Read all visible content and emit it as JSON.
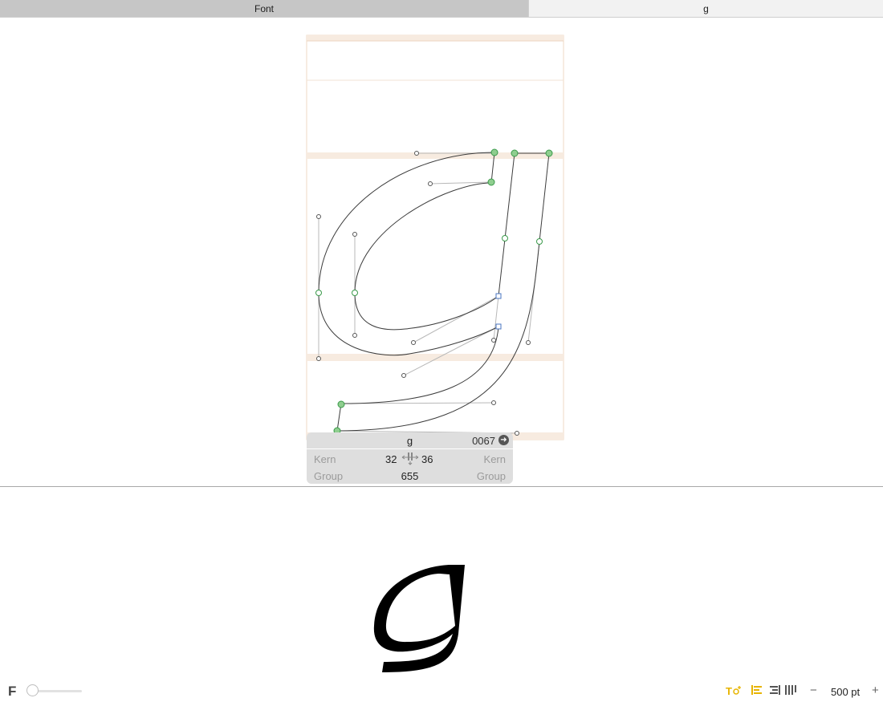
{
  "tabs": [
    {
      "label": "Font",
      "active": true
    },
    {
      "label": "g",
      "active": false
    }
  ],
  "glyph": {
    "name": "g",
    "unicode": "0067",
    "kern_left_label": "Kern",
    "kern_right_label": "Kern",
    "group_left_label": "Group",
    "group_right_label": "Group",
    "left_sidebearing": "32",
    "right_sidebearing": "36",
    "width": "655"
  },
  "preview": {
    "text": "g"
  },
  "bottom_bar": {
    "font_icon_label": "F",
    "size_slider_value": 0,
    "zoom": "500 pt",
    "zoom_minus": "−",
    "zoom_plus": "+"
  },
  "colors": {
    "accent_yellow": "#e7b400",
    "node_green": "#3a9a4a",
    "metric_band": "#f7ebe0"
  }
}
